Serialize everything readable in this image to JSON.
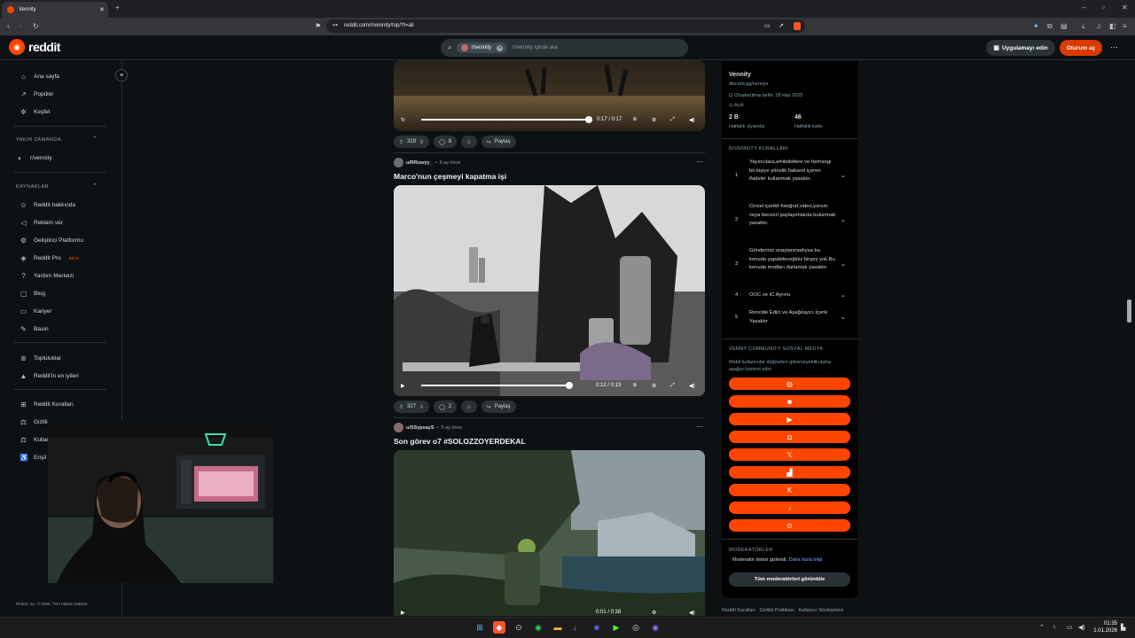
{
  "browser": {
    "tab_title": "Vennity",
    "url": "reddit.com/r/vennity/top/?t=all"
  },
  "header": {
    "logo_text": "reddit",
    "search_chip": "r/vennity",
    "search_placeholder": "r/vennity içinde ara",
    "get_app": "Uygulamayı edin",
    "login": "Oturum aç"
  },
  "sidebar": {
    "nav": [
      {
        "label": "Ana sayfa",
        "icon": "home-icon"
      },
      {
        "label": "Popüler",
        "icon": "popular-icon"
      },
      {
        "label": "Keşfet",
        "icon": "explore-icon"
      }
    ],
    "recent_header": "YAKIN ZAMANDA",
    "recent": [
      {
        "label": "r/vennity"
      }
    ],
    "resources_header": "KAYNAKLAR",
    "resources": [
      {
        "label": "Reddit hakkında"
      },
      {
        "label": "Reklam ver"
      },
      {
        "label": "Geliştirici Platformu"
      },
      {
        "label": "Reddit Pro",
        "badge": "BETA"
      },
      {
        "label": "Yardım Merkezi"
      },
      {
        "label": "Blog"
      },
      {
        "label": "Kariyer"
      },
      {
        "label": "Basın"
      }
    ],
    "communities": [
      {
        "label": "Topluluklar"
      },
      {
        "label": "Reddit'in en iyileri"
      }
    ],
    "policies": [
      {
        "label": "Reddit Kuralları"
      },
      {
        "label": "Gizlili"
      },
      {
        "label": "Kullan"
      },
      {
        "label": "Erişil"
      }
    ],
    "copyright": "Reddit, Inc. © 2025. Tüm hakları saklıdır."
  },
  "posts": [
    {
      "time": "0:17 / 0:17",
      "progress": 1.0,
      "votes": "329",
      "comments": "8",
      "share": "Paylaş"
    },
    {
      "user": "u/RRowyy_",
      "age": "6 ay önce",
      "title": "Marco'nun çeşmeyi kapatma işi",
      "time": "0:12 / 0:13",
      "progress": 0.95,
      "votes": "327",
      "comments": "2",
      "share": "Paylaş"
    },
    {
      "user": "u/SSypsayS",
      "age": "5 ay önce",
      "title": "Son görev o7 #SOLOZZOYERDEKAL",
      "time": "0:01 / 0:38"
    }
  ],
  "panel": {
    "name": "Vennity",
    "discord": "discord.gg/vennyv",
    "created": "Oluşturulma tarihi: 18 Haz 2025",
    "visibility": "Açık",
    "visitors_value": "2 B",
    "visitors_label": "Haftalık ziyaretçi",
    "contrib_value": "46",
    "contrib_label": "Haftalık katkı",
    "rules_header": "R/VENNITY KURALLARI",
    "rules": [
      {
        "n": "1",
        "text": "Yayıncılara,whitelistlere ve herhangi bir kişiye yönelik hakaret içeren ifadeler kullanmak yasaktır."
      },
      {
        "n": "2",
        "text": "Cinsel içerikli fotoğraf,video,yorum veya benzeri paylaşımlarda bulunmak yasaktır."
      },
      {
        "n": "3",
        "text": "Gönderiniz onaylanmadıysa bu konuda yapabileceğiniz birşey yok.Bu konuda modları darlamak yasaktır."
      },
      {
        "n": "4",
        "text": "OOC ve IC Ayrımı"
      },
      {
        "n": "5",
        "text": "Rencide Edici ve Aşağılayıcı İçerik Yasaktır"
      }
    ],
    "social_header": "VENNY COMMUNITY SOSYAL MEDYA",
    "social_note": "Mobil kullanıcılar düğmeleri göremeyebilir,daha aşağıyı kontrol edin.",
    "social_icons": [
      "website-icon",
      "discord-icon",
      "youtube-icon",
      "instagram-icon",
      "x-icon",
      "twitch-icon",
      "kick-icon",
      "tiktok-icon",
      "steam-icon"
    ],
    "mods_header": "MODERATÖRLER",
    "mods_hidden": "Moderatör listesi gizlendi.",
    "mods_link": "Daha fazla bilgi",
    "mods_button": "Tüm moderatörleri görüntüle",
    "footer_links": "Reddit Kuralları   Gizlilik Politikası   Kullanıcı Sözleşmesi"
  },
  "taskbar": {
    "time": "01:35",
    "date": "1.01.2026"
  },
  "colors": {
    "accent": "#ff4500",
    "login": "#d93a00",
    "background": "#0e1113"
  }
}
